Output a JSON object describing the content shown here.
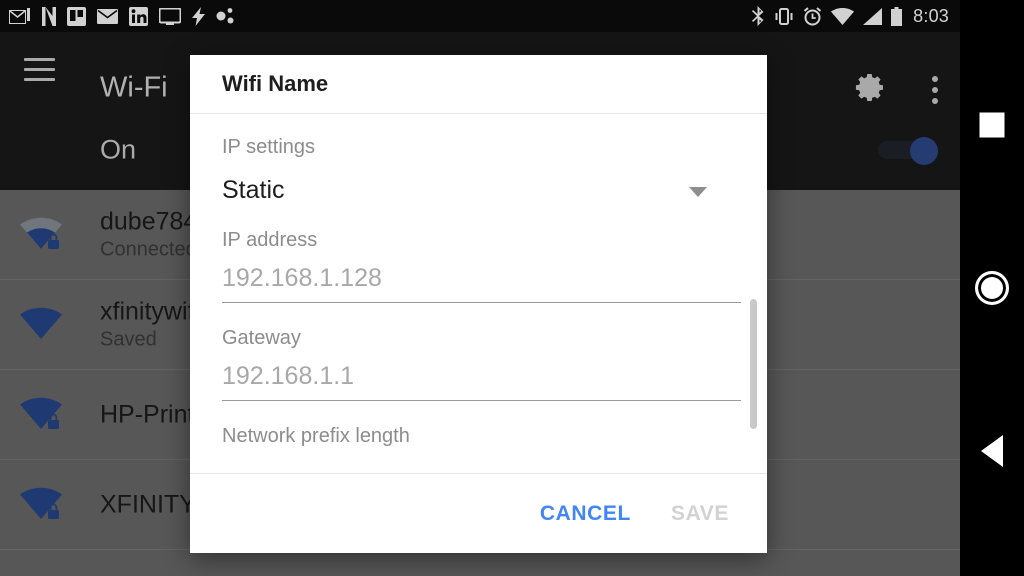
{
  "statusbar": {
    "left_icons": [
      "gmail-icon",
      "netflix-icon",
      "trello-icon",
      "mail-icon",
      "linkedin-icon",
      "cast-screen-icon",
      "flash-icon",
      "scatter-icon"
    ],
    "right_icons": [
      "bluetooth-icon",
      "vibrate-icon",
      "alarm-icon",
      "wifi-icon",
      "cell-signal-icon",
      "battery-icon"
    ],
    "clock": "8:03"
  },
  "appbar": {
    "title": "Wi-Fi",
    "menu_icon": "hamburger-icon",
    "settings_icon": "gear-icon",
    "overflow_icon": "more-vertical-icon"
  },
  "wifi_state": {
    "label": "On",
    "toggle_on": true,
    "toggle_color": "#2d4a8a"
  },
  "networks": [
    {
      "ssid": "dube784",
      "status": "Connected",
      "secured": true,
      "signal": "2-bars"
    },
    {
      "ssid": "xfinitywif",
      "status": "Saved",
      "secured": false,
      "signal": "full"
    },
    {
      "ssid": "HP-Print-",
      "status": "",
      "secured": true,
      "signal": "full"
    },
    {
      "ssid": "XFINITY",
      "status": "",
      "secured": true,
      "signal": "full"
    }
  ],
  "dialog": {
    "title": "Wifi Name",
    "ip_settings_label": "IP settings",
    "ip_settings_value": "Static",
    "ip_address_label": "IP address",
    "ip_address_value": "192.168.1.128",
    "gateway_label": "Gateway",
    "gateway_value": "192.168.1.1",
    "network_prefix_label": "Network prefix length",
    "cancel_label": "CANCEL",
    "save_label": "SAVE",
    "cancel_color": "#4285f4",
    "save_color": "#d2d2d2"
  },
  "navbar": {
    "recents": "square-recents-icon",
    "home": "circle-home-icon",
    "back": "triangle-back-icon"
  }
}
